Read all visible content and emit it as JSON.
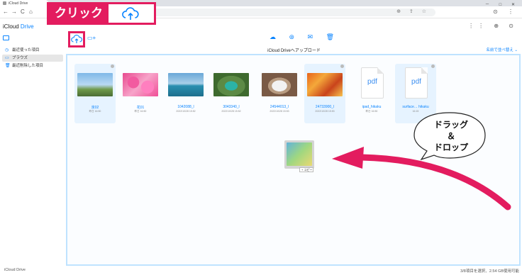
{
  "browser": {
    "tab_title": "iCloud Drive",
    "window_controls": "－ □ ✕",
    "nav": {
      "back": "←",
      "forward": "→",
      "reload": "C",
      "home": "⌂"
    },
    "omnibox_icons": "⊕ ⇪ ☆",
    "toolbar_right": "⊙ ⋮"
  },
  "annotations": {
    "click_label": "クリック",
    "drag_text_line1": "ドラッグ",
    "drag_text_line2": "＆",
    "drag_text_line3": "ドロップ"
  },
  "icloud": {
    "logo_prefix": "iCloud",
    "logo_drive": "Drive",
    "header_right": "⋮⋮ ⊕ ⊙"
  },
  "sidebar": {
    "items": [
      {
        "label": "最近使った項目",
        "icon": "◷"
      },
      {
        "label": "ブラウズ",
        "icon": "▭"
      },
      {
        "label": "最近削除した項目",
        "icon": "🗑"
      }
    ]
  },
  "main": {
    "toolbar_icons": "☁ ⊛ ✉ 🗑",
    "folder_icon": "▭+",
    "title": "iCloud Driveへアップロード",
    "sort_label": "名前で並べ替え ⌄"
  },
  "files": [
    {
      "name": "京02",
      "meta": "昨日 16:50",
      "selected": true
    },
    {
      "name": "花01",
      "meta": "昨日 16:50",
      "selected": false
    },
    {
      "name": "1042088_l",
      "meta": "2022/10/28 15:52",
      "selected": false
    },
    {
      "name": "3043340_l",
      "meta": "2022/10/28 15:52",
      "selected": false
    },
    {
      "name": "24544013_l",
      "meta": "2022/10/28 15:53",
      "selected": false
    },
    {
      "name": "24733900_l",
      "meta": "2022/10/28 15:53",
      "selected": true
    },
    {
      "name": "ipad_hikaku",
      "meta": "昨日 16:50",
      "selected": false,
      "pdf_label": "pdf"
    },
    {
      "name": "surface… hikaku",
      "meta": "16:15",
      "selected": true,
      "pdf_label": "pdf"
    }
  ],
  "drag": {
    "copy_label": "+ コピー"
  },
  "status": {
    "brand": "iCloud Drive",
    "selection": "3/8項目を選択、2.54 GB使用可能"
  },
  "colors": {
    "accent": "#0a84ff",
    "annotation": "#e31c5f"
  }
}
